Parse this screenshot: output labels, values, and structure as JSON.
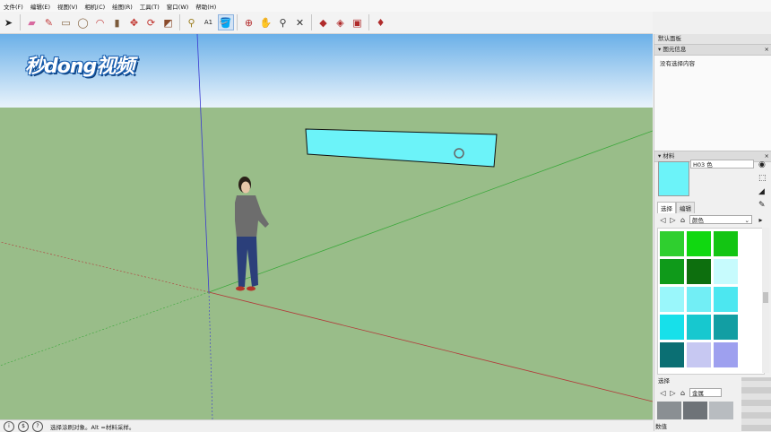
{
  "menus": [
    "文件(F)",
    "编辑(E)",
    "视图(V)",
    "相机(C)",
    "绘图(R)",
    "工具(T)",
    "窗口(W)",
    "帮助(H)"
  ],
  "toolbar_icons": [
    "select-arrow-icon",
    "eraser-icon",
    "pencil-icon",
    "rectangle-icon",
    "circle-icon",
    "arc-icon",
    "push-pull-icon",
    "move-icon",
    "rotate-icon",
    "scale-icon",
    "offset-icon",
    "tape-measure-icon",
    "text-icon",
    "paint-bucket-icon",
    "orbit-icon",
    "pan-icon",
    "zoom-icon",
    "zoom-extents-icon",
    "warehouse-icon",
    "components-icon",
    "extension-icon",
    "ruby-icon"
  ],
  "watermark": "秒dong视频",
  "status": {
    "text": "选择涂刷对象。Alt =材料采样。"
  },
  "tray": {
    "title": "默认面板",
    "entity_info": {
      "header": "图元信息",
      "body": "没有选择内容"
    },
    "materials": {
      "header": "材料",
      "current_name": "H03 色",
      "current_color": "#6cf3f9",
      "tabs": [
        "选择",
        "编辑"
      ],
      "library": "颜色",
      "swatches": [
        [
          "#2fcf2f",
          "#10d810",
          "#13c513"
        ],
        [
          "#0f9a1a",
          "#0d6f0e",
          "#c7fbfd"
        ],
        [
          "#9af7fb",
          "#72eef5",
          "#4ce7f0"
        ],
        [
          "#17e0ea",
          "#17c8cf",
          "#129ea3"
        ],
        [
          "#0b6f73",
          "#c7c8f2",
          "#9ea0ef"
        ]
      ],
      "secondary_label": "选择",
      "secondary_library": "金属",
      "secondary_swatches": [
        "#8a8f93",
        "#6e7378",
        "#b8bcc0"
      ]
    },
    "bottom_label": "数值"
  }
}
